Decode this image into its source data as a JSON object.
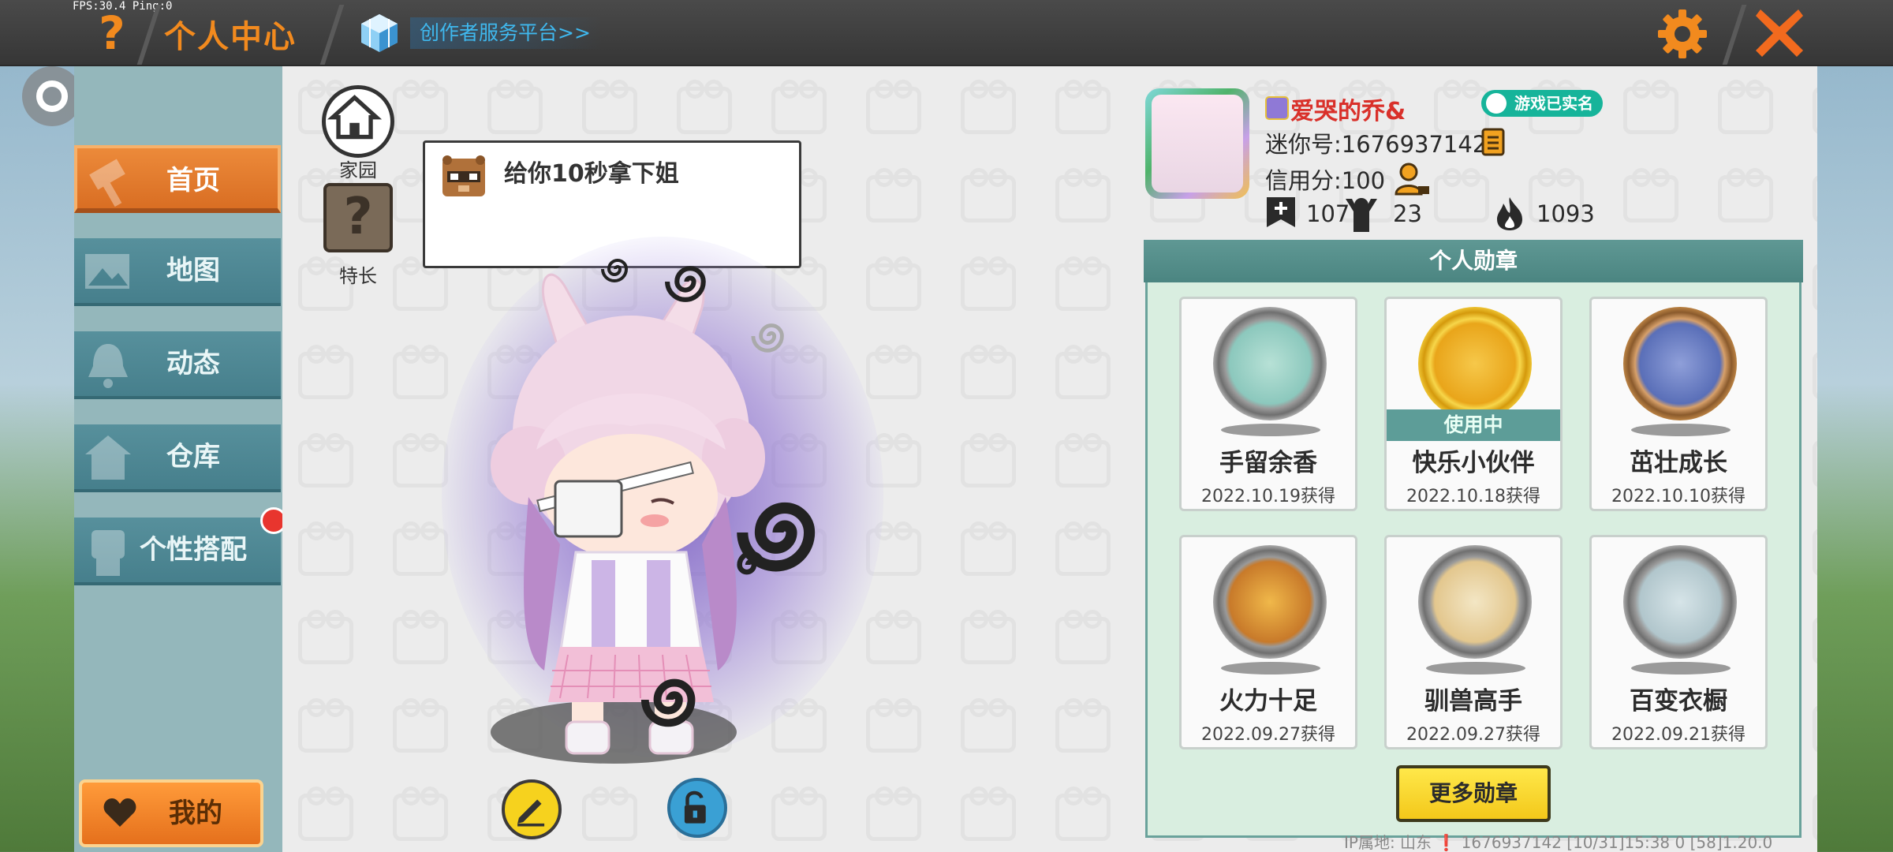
{
  "status": {
    "fps": "FPS:30.4  Ping:0"
  },
  "header": {
    "title": "个人中心",
    "creator_link": "创作者服务平台>>",
    "help_icon": "question-mark-icon",
    "settings_icon": "gear-icon",
    "close_icon": "close-x-icon"
  },
  "sidebar": {
    "items": [
      {
        "label": "首页",
        "icon": "hammer-icon",
        "active": true
      },
      {
        "label": "地图",
        "icon": "picture-icon",
        "active": false
      },
      {
        "label": "动态",
        "icon": "bell-icon",
        "active": false
      },
      {
        "label": "仓库",
        "icon": "house-icon",
        "active": false
      },
      {
        "label": "个性搭配",
        "icon": "character-icon",
        "active": false,
        "badge": true
      }
    ],
    "mine_label": "我的"
  },
  "showcase": {
    "home_label": "家园",
    "skill_label": "特长",
    "bubble_text": "给你10秒拿下姐",
    "edit_icon": "pencil-icon",
    "lock_icon": "lock-icon"
  },
  "profile": {
    "nickname": "爱哭的乔&",
    "verify_label": "游戏已实名",
    "mini_id": "迷你号:1676937142",
    "credit": "信用分:100",
    "stats": {
      "plus": "107",
      "fans": "23",
      "heat": "1093"
    }
  },
  "medals": {
    "title": "个人勋章",
    "items": [
      {
        "name": "手留余香",
        "date": "2022.10.19获得",
        "using": false
      },
      {
        "name": "快乐小伙伴",
        "date": "2022.10.18获得",
        "using": true,
        "using_label": "使用中"
      },
      {
        "name": "茁壮成长",
        "date": "2022.10.10获得",
        "using": false
      },
      {
        "name": "火力十足",
        "date": "2022.09.27获得",
        "using": false
      },
      {
        "name": "驯兽高手",
        "date": "2022.09.27获得",
        "using": false
      },
      {
        "name": "百变衣橱",
        "date": "2022.09.21获得",
        "using": false
      }
    ],
    "more_label": "更多勋章"
  },
  "footer": {
    "text": "IP属地: 山东 ❗    1676937142    [10/31]15:38 0  [58]1.20.0"
  },
  "colors": {
    "accent": "#f28a1e",
    "nav": "#467f8c",
    "panel": "#d9eee0",
    "verify": "#16b49a",
    "nickname": "#d9302a"
  }
}
